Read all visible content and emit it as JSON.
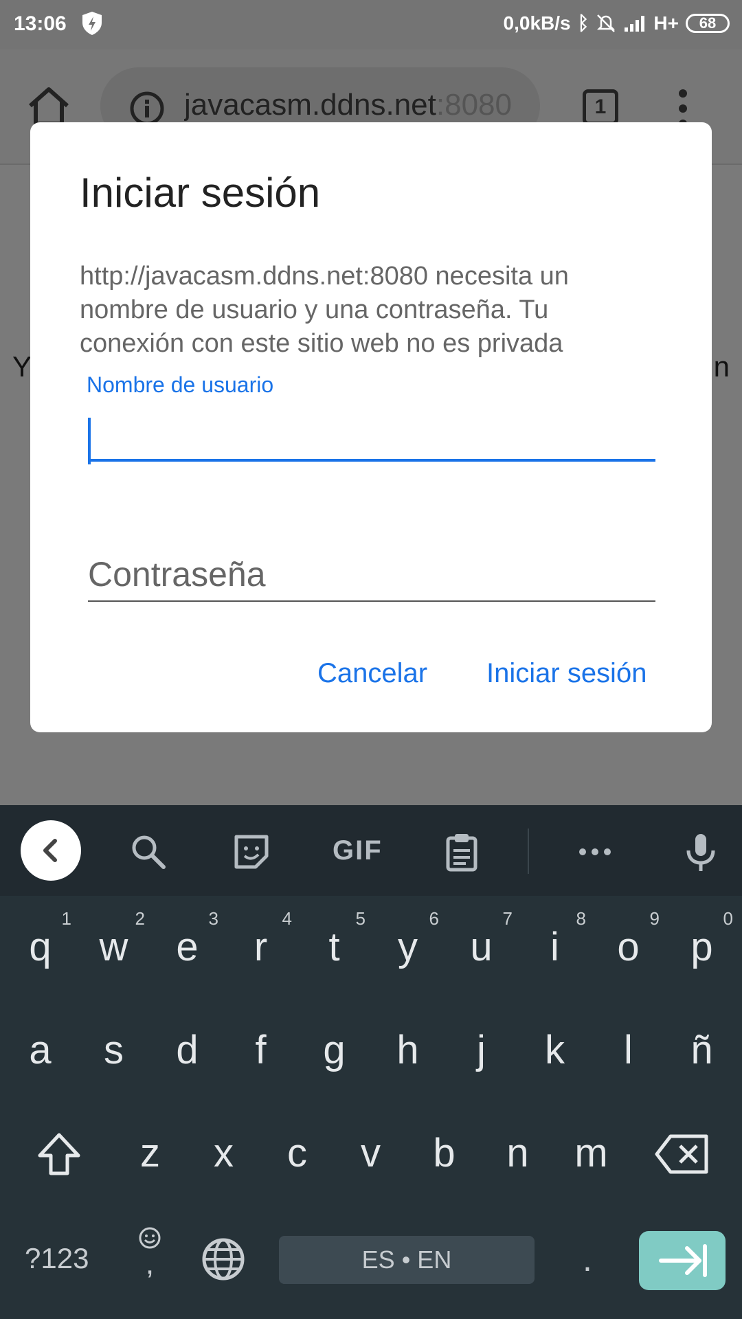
{
  "status_bar": {
    "time": "13:06",
    "network_speed": "0,0kB/s",
    "signal_type": "H+",
    "battery": "68"
  },
  "browser": {
    "url_host": "javacasm.ddns.net",
    "url_port": ":8080",
    "tab_count": "1",
    "page_fragment_left": "Y",
    "page_fragment_right": "n"
  },
  "dialog": {
    "title": "Iniciar sesión",
    "message": "http://javacasm.ddns.net:8080 necesita un nombre de usuario y una contraseña. Tu conexión con este sitio web no es privada",
    "username_label": "Nombre de usuario",
    "username_value": "",
    "password_placeholder": "Contraseña",
    "cancel_label": "Cancelar",
    "login_label": "Iniciar sesión",
    "accent_color": "#1a73e8"
  },
  "keyboard": {
    "toolbar_gif": "GIF",
    "row1": [
      {
        "key": "q",
        "hint": "1"
      },
      {
        "key": "w",
        "hint": "2"
      },
      {
        "key": "e",
        "hint": "3"
      },
      {
        "key": "r",
        "hint": "4"
      },
      {
        "key": "t",
        "hint": "5"
      },
      {
        "key": "y",
        "hint": "6"
      },
      {
        "key": "u",
        "hint": "7"
      },
      {
        "key": "i",
        "hint": "8"
      },
      {
        "key": "o",
        "hint": "9"
      },
      {
        "key": "p",
        "hint": "0"
      }
    ],
    "row2": [
      "a",
      "s",
      "d",
      "f",
      "g",
      "h",
      "j",
      "k",
      "l",
      "ñ"
    ],
    "row3": [
      "z",
      "x",
      "c",
      "v",
      "b",
      "n",
      "m"
    ],
    "symbols_label": "?123",
    "comma": ",",
    "space_label": "ES • EN",
    "period": ".",
    "enter_color": "#80cbc4"
  }
}
